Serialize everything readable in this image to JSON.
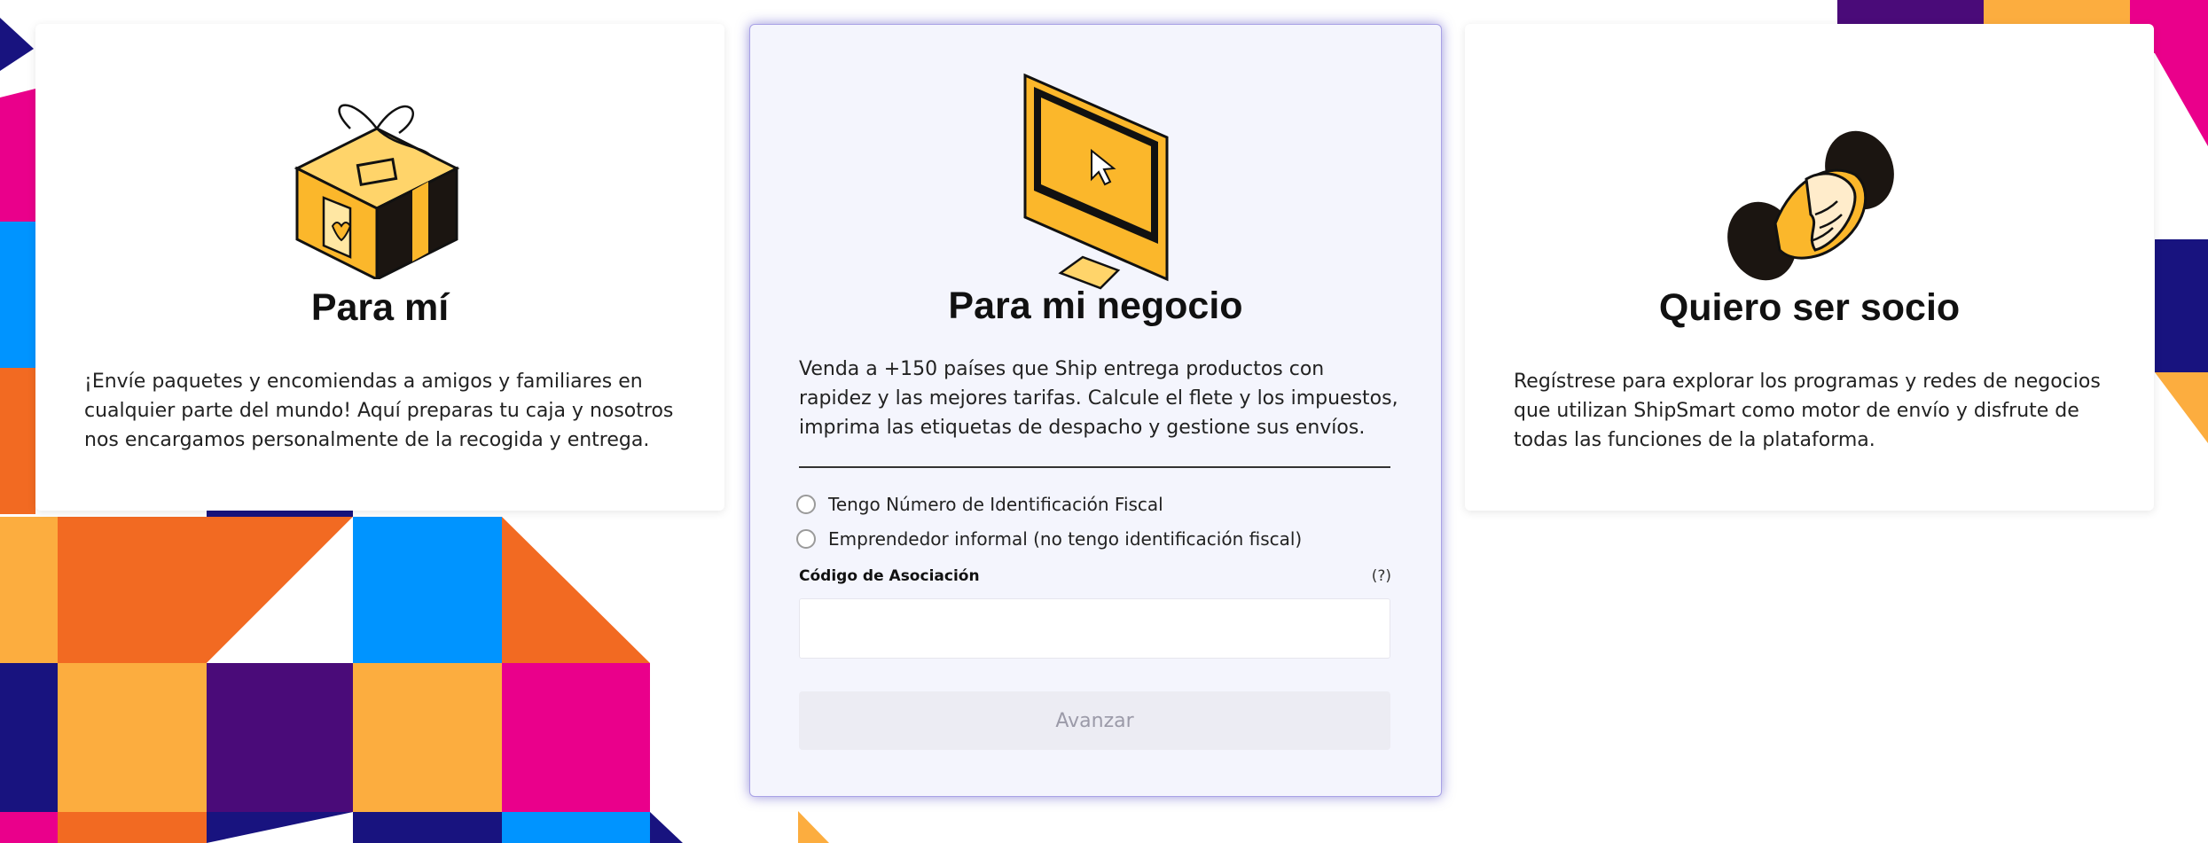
{
  "colors": {
    "navy": "#18137f",
    "purple": "#4a0b79",
    "magenta": "#ea008b",
    "blue": "#0094ff",
    "orange": "#f26a22",
    "amber": "#fcad3f",
    "gold": "#fbb72b"
  },
  "cards": {
    "personal": {
      "title": "Para mí",
      "description": "¡Envíe paquetes y encomiendas a amigos y familiares en cualquier parte del mundo! Aquí preparas tu caja y nosotros nos encargamos personalmente de la recogida y entrega.",
      "icon": "gift-box-icon"
    },
    "business": {
      "title": "Para mi negocio",
      "description": "Venda a +150 países que Ship entrega productos con rapidez y las mejores tarifas. Calcule el flete y los impuestos, imprima las etiquetas de despacho y gestione sus envíos.",
      "icon": "computer-monitor-icon",
      "options": [
        "Tengo Número de Identificación Fiscal",
        "Emprendedor informal (no tengo identificación fiscal)"
      ],
      "field_label": "Código de Asociación",
      "help": "(?)",
      "input_value": "",
      "button_label": "Avanzar"
    },
    "partner": {
      "title": "Quiero ser socio",
      "description": "Regístrese para explorar los programas y redes de negocios que utilizan ShipSmart como motor de envío y disfrute de todas las funciones de la plataforma.",
      "icon": "handshake-icon"
    }
  }
}
